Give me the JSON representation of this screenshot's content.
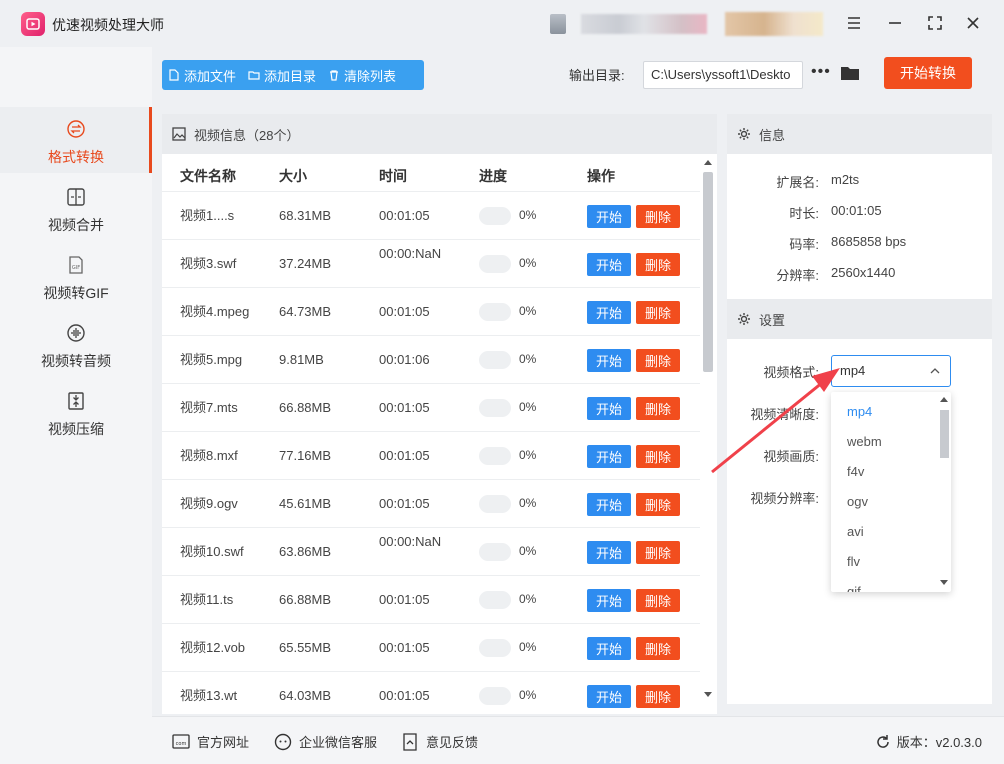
{
  "app": {
    "title": "优速视频处理大师"
  },
  "sidebar": {
    "items": [
      {
        "label": "格式转换",
        "icon": "swap-circle-icon"
      },
      {
        "label": "视频合并",
        "icon": "merge-icon"
      },
      {
        "label": "视频转GIF",
        "icon": "gif-file-icon"
      },
      {
        "label": "视频转音频",
        "icon": "audio-wave-icon"
      },
      {
        "label": "视频压缩",
        "icon": "compress-icon"
      }
    ]
  },
  "toolbar": {
    "add_file": "添加文件",
    "add_dir": "添加目录",
    "clear_list": "清除列表",
    "output_label": "输出目录:",
    "output_path": "C:\\Users\\yssoft1\\Deskto",
    "more": "•••",
    "start_all": "开始转换"
  },
  "list": {
    "header": "视频信息（28个）",
    "columns": [
      "文件名称",
      "大小",
      "时间",
      "进度",
      "操作"
    ],
    "start_label": "开始",
    "delete_label": "删除",
    "rows": [
      {
        "name": "视频1....s",
        "size": "68.31MB",
        "time": "00:01:05",
        "progress": "0%"
      },
      {
        "name": "视频3.swf",
        "size": "37.24MB",
        "time": "00:00:NaN",
        "progress": "0%"
      },
      {
        "name": "视频4.mpeg",
        "size": "64.73MB",
        "time": "00:01:05",
        "progress": "0%"
      },
      {
        "name": "视频5.mpg",
        "size": "9.81MB",
        "time": "00:01:06",
        "progress": "0%"
      },
      {
        "name": "视频7.mts",
        "size": "66.88MB",
        "time": "00:01:05",
        "progress": "0%"
      },
      {
        "name": "视频8.mxf",
        "size": "77.16MB",
        "time": "00:01:05",
        "progress": "0%"
      },
      {
        "name": "视频9.ogv",
        "size": "45.61MB",
        "time": "00:01:05",
        "progress": "0%"
      },
      {
        "name": "视频10.swf",
        "size": "63.86MB",
        "time": "00:00:NaN",
        "progress": "0%"
      },
      {
        "name": "视频11.ts",
        "size": "66.88MB",
        "time": "00:01:05",
        "progress": "0%"
      },
      {
        "name": "视频12.vob",
        "size": "65.55MB",
        "time": "00:01:05",
        "progress": "0%"
      },
      {
        "name": "视频13.wt",
        "size": "64.03MB",
        "time": "00:01:05",
        "progress": "0%"
      }
    ]
  },
  "info": {
    "header": "信息",
    "ext_label": "扩展名:",
    "ext": "m2ts",
    "dur_label": "时长:",
    "dur": "00:01:05",
    "rate_label": "码率:",
    "rate": "8685858 bps",
    "res_label": "分辨率:",
    "res": "2560x1440"
  },
  "settings": {
    "header": "设置",
    "format_label": "视频格式:",
    "format_value": "mp4",
    "clarity_label": "视频清晰度:",
    "quality_label": "视频画质:",
    "resolution_label": "视频分辨率:",
    "options": [
      "mp4",
      "webm",
      "f4v",
      "ogv",
      "avi",
      "flv",
      "gif"
    ]
  },
  "footer": {
    "website": "官方网址",
    "wechat": "企业微信客服",
    "feedback": "意见反馈",
    "version": "版本：v2.0.3.0"
  },
  "colors": {
    "accent": "#f24e1e",
    "primary": "#2e8cf0",
    "toolbar_blue": "#3aa0f0"
  }
}
